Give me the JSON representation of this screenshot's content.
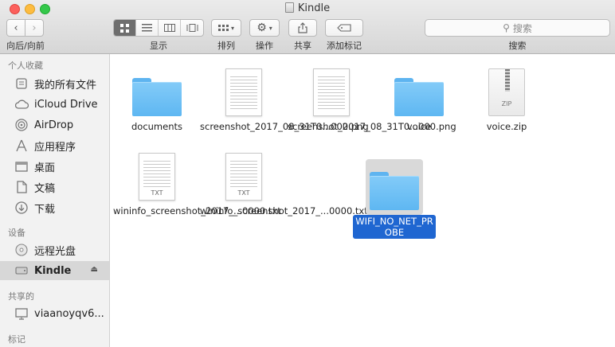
{
  "window": {
    "title": "Kindle"
  },
  "toolbar": {
    "nav_label": "向后/向前",
    "view_label": "显示",
    "arrange_label": "排列",
    "action_label": "操作",
    "share_label": "共享",
    "tags_label": "添加标记",
    "search_label": "搜索",
    "search_placeholder": "搜索"
  },
  "sidebar": {
    "favorites_header": "个人收藏",
    "favorites": [
      {
        "label": "我的所有文件",
        "icon": "all-files-icon"
      },
      {
        "label": "iCloud Drive",
        "icon": "cloud-icon"
      },
      {
        "label": "AirDrop",
        "icon": "airdrop-icon"
      },
      {
        "label": "应用程序",
        "icon": "applications-icon"
      },
      {
        "label": "桌面",
        "icon": "desktop-icon"
      },
      {
        "label": "文稿",
        "icon": "documents-icon"
      },
      {
        "label": "下载",
        "icon": "downloads-icon"
      }
    ],
    "devices_header": "设备",
    "devices": [
      {
        "label": "远程光盘",
        "icon": "disc-icon"
      },
      {
        "label": "Kindle",
        "icon": "drive-icon",
        "selected": true
      }
    ],
    "shared_header": "共享的",
    "shared": [
      {
        "label": "viaanoyqv6...",
        "icon": "computer-icon"
      }
    ],
    "tags_header": "标记"
  },
  "files": [
    {
      "name": "documents",
      "kind": "folder"
    },
    {
      "name": "screenshot_2017_08_31T0...000.png",
      "kind": "png"
    },
    {
      "name": "screenshot_2017_08_31T0...000.png",
      "kind": "png"
    },
    {
      "name": "voice",
      "kind": "folder"
    },
    {
      "name": "voice.zip",
      "kind": "zip",
      "type_label": "ZIP"
    },
    {
      "name": "wininfo_screenshot_2017_...0000.txt",
      "kind": "txt",
      "type_label": "TXT"
    },
    {
      "name": "wininfo_screenshot_2017_...0000.txt",
      "kind": "txt",
      "type_label": "TXT"
    },
    {
      "name": "WIFI_NO_NET_PROBE",
      "kind": "folder",
      "selected": true
    }
  ],
  "colors": {
    "folder": "#6cbdf4",
    "selection": "#1f66d1",
    "sidebar_bg": "#f2f2f2"
  }
}
